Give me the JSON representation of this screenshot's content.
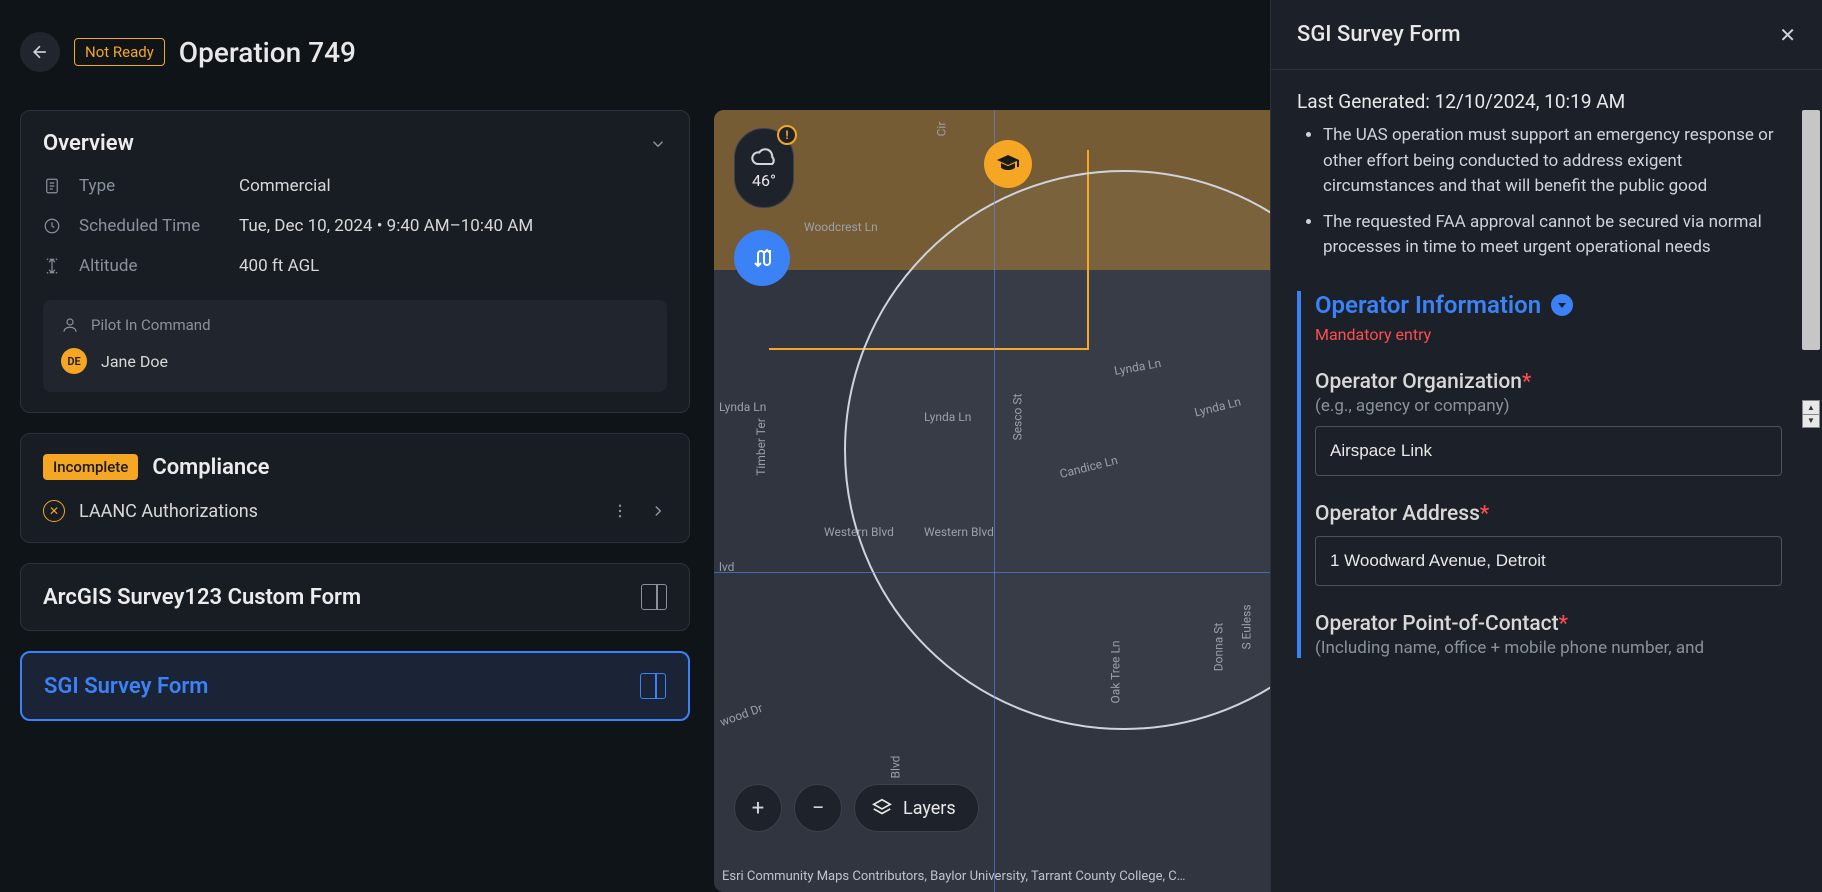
{
  "header": {
    "status": "Not Ready",
    "title": "Operation 749"
  },
  "overview": {
    "title": "Overview",
    "type_label": "Type",
    "type_value": "Commercial",
    "time_label": "Scheduled Time",
    "time_value": "Tue, Dec 10, 2024 • 9:40 AM–10:40 AM",
    "altitude_label": "Altitude",
    "altitude_value": "400 ft AGL",
    "pilot_label": "Pilot In Command",
    "pilot_initials": "DE",
    "pilot_name": "Jane Doe"
  },
  "compliance": {
    "badge": "Incomplete",
    "title": "Compliance",
    "laanc_label": "LAANC Authorizations"
  },
  "forms": {
    "survey123_title": "ArcGIS Survey123 Custom Form",
    "sgi_title": "SGI Survey Form"
  },
  "map": {
    "temperature": "46°",
    "layers_label": "Layers",
    "attribution": "Esri Community Maps Contributors, Baylor University, Tarrant County College, C…",
    "streets": {
      "woodcrest": "Woodcrest Ln",
      "lynda1": "Lynda Ln",
      "lynda2": "Lynda Ln",
      "lynda3": "Lynda Ln",
      "lynda4": "Lynda Ln",
      "candice": "Candice Ln",
      "western1": "Western Blvd",
      "western2": "Western Blvd",
      "lvd": "lvd",
      "timber": "Timber Ter",
      "sesco": "Sesco St",
      "oaktree": "Oak Tree Ln",
      "donna": "Donna St",
      "euless": "S Euless",
      "wood_dr": "wood Dr",
      "blvd_v": "Blvd",
      "cir": "Cir"
    }
  },
  "panel": {
    "title": "SGI Survey Form",
    "last_generated_label": "Last Generated: ",
    "last_generated_value": "12/10/2024, 10:19 AM",
    "requirements": [
      "The UAS operation must support an emergency response or other effort being conducted to address exigent circumstances and that will benefit the public good",
      "The requested FAA approval cannot be secured via normal processes in time to meet urgent operational needs"
    ],
    "section_title": "Operator Information",
    "mandatory": "Mandatory entry",
    "org_label": "Operator Organization",
    "org_hint": "(e.g., agency or company)",
    "org_value": "Airspace Link",
    "addr_label": "Operator Address",
    "addr_value": "1 Woodward Avenue, Detroit",
    "poc_label": "Operator Point-of-Contact",
    "poc_hint": "(Including name, office + mobile phone number, and"
  }
}
